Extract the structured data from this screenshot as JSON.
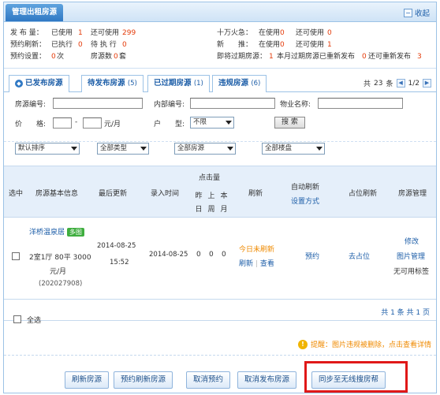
{
  "header": {
    "title": "管理出租房源",
    "collapse_label": "收起",
    "collapse_icon": "minus-square-icon"
  },
  "stats": {
    "row1": {
      "publish_label": "发 布 量：",
      "in_use_label": "已使用",
      "in_use": "1",
      "remaining_label": "还可使用",
      "remaining": "299",
      "fire_label": "十万火急：",
      "fire_in_use_label": "在使用",
      "fire_in_use": "0",
      "fire_remaining_label": "还可使用",
      "fire_remaining": "0"
    },
    "row2": {
      "reserve_label": "预约刷新：",
      "executed_label": "已执行",
      "executed": "0",
      "pending_label": "待 执 行",
      "pending": "0",
      "new_label": "新　　推：",
      "new_in_use_label": "在使用",
      "new_in_use": "0",
      "new_remaining_label": "还可使用",
      "new_remaining": "1"
    },
    "row3": {
      "reserve_setting_label": "预约设置：",
      "reserve_count": "0",
      "reserve_unit": "次",
      "house_count_label": "房源数",
      "house_count": "0",
      "house_unit": "套",
      "expiring_label": "即将过期房源：",
      "expiring": "1",
      "this_month_label": "本月过期房源已重新发布",
      "this_month": "0",
      "republish_label": "还可重新发布",
      "republish": "3"
    }
  },
  "tabs": [
    {
      "label": "已发布房源",
      "count": ""
    },
    {
      "label": "待发布房源",
      "count": "(5)"
    },
    {
      "label": "已过期房源",
      "count": "(1)"
    },
    {
      "label": "违规房源",
      "count": "(6)"
    }
  ],
  "pager_top": {
    "total_prefix": "共",
    "total": "23",
    "total_suffix": "条",
    "page": "1/2"
  },
  "search": {
    "house_id_label": "房源编号:",
    "internal_id_label": "内部编号:",
    "property_label": "物业名称:",
    "price_label": "价　　格:",
    "price_dash": "-",
    "price_unit": "元/月",
    "layout_label": "户　　型:",
    "layout_value": "不限",
    "search_button": "搜 索",
    "sort_value": "默认排序",
    "type_value": "全部类型",
    "house_value": "全部房源",
    "estate_value": "全部楼盘"
  },
  "table": {
    "headers": {
      "select": "选中",
      "info": "房源基本信息",
      "updated": "最后更新",
      "entered": "录入时间",
      "clicks": "点击量",
      "click_cols": [
        "昨日",
        "上周",
        "本月"
      ],
      "refresh": "刷新",
      "auto_refresh": "自动刷新",
      "refresh_mode": "设置方式",
      "pin_refresh": "占位刷新",
      "manage": "房源管理"
    },
    "rows": [
      {
        "name": "洋桥温泉居",
        "badge": "多图",
        "layout": "2室1厅",
        "area": "80平",
        "price": "3000",
        "price_unit": "元/月",
        "code": "(202027908)",
        "updated_date": "2014-08-25",
        "updated_time": "15:52",
        "entered": "2014-08-25",
        "clicks": [
          "0",
          "0",
          "0"
        ],
        "refresh_status": "今日未刷新",
        "refresh_link": "刷新",
        "view_link": "查看",
        "reserve_link": "预约",
        "pin_link": "去占位",
        "edit_link": "修改",
        "image_link": "图片管理",
        "tag_text": "无可用标签"
      }
    ]
  },
  "pager_bottom": {
    "text": "共 1 条 共 1 页"
  },
  "select_all": "全选",
  "warning": {
    "prefix": "提醒：",
    "text": "图片违规被删除，点击查看详情"
  },
  "actions": [
    "刷新房源",
    "预约刷新房源",
    "取消预约",
    "取消发布房源",
    "同步至无线搜房帮"
  ]
}
